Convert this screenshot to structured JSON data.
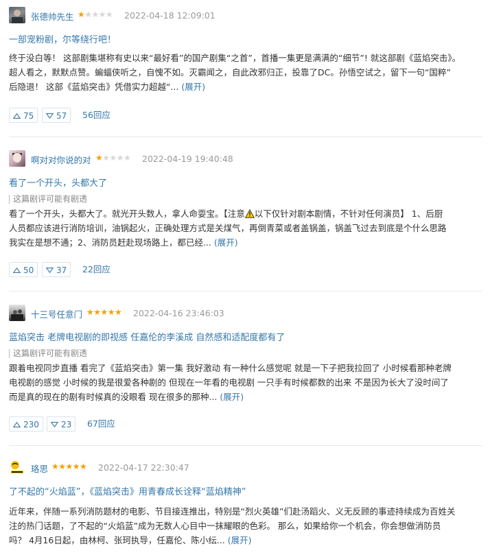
{
  "reviews": [
    {
      "username": "张德帅先生",
      "rating_stars": 1,
      "date": "2022-04-18 12:09:01",
      "title": "一部宠粉剧，尔等绕行吧！",
      "spoiler_note": "",
      "body_lines": [
        "终于没白等！  这部剧集堪称有史以来“最好看”的国产剧集“之首”，首播一集更是满满的“细节”! 就这部剧《蓝焰突击》。",
        "超人看之，默默点赞。蝙蝠侠听之，自愧不如。灭霸闻之，自此改邪归正，投靠了DC。孙悟空试之，留下一句“国粹”",
        "后隐退！ 这部《蓝焰突击》凭借实力超越“..."
      ],
      "expand": "(展开)",
      "useful": "75",
      "useless": "57",
      "replies": "56回应"
    },
    {
      "username": "啊对对你说的对",
      "rating_stars": 1,
      "date": "2022-04-19 19:40:48",
      "title": "看了一个开头，头都大了",
      "spoiler_note": "这篇剧评可能有剧透",
      "body_line1_before": "看了一个开头，头都大了。就光开头数人，拿人命耍宝。【注意",
      "body_line1_after": "以下仅针对剧本剧情，不针对任何演员】 1、后厨",
      "body_lines": [
        "人员都应该进行消防培训，油锅起火，正确处理方式是关煤气，再倒青菜或者盖锅盖，锅盖飞过去到底是个什么思路",
        "我实在是想不通；2、消防员赶赴现场路上，都已经..."
      ],
      "expand": "(展开)",
      "useful": "50",
      "useless": "37",
      "replies": "22回应"
    },
    {
      "username": "十三号任意门",
      "rating_stars": 5,
      "date": "2022-04-16 23:46:03",
      "title": "蓝焰突击 老牌电视剧的即视感 任嘉伦的李溪成 自然感和适配度都有了",
      "spoiler_note": "这篇剧评可能有剧透",
      "body_lines": [
        "跟着电视同步直播 看完了《蓝焰突击》第一集 我好激动 有一种什么感觉呢 就是一下子把我拉回了 小时候看那种老牌",
        "电视剧的感觉 小时候的我是很爱各种剧的 但现在一年看的电视剧 一只手有时候都数的出来 不是因为长大了没时间了",
        "而是真的现在的剧有时候真的没眼看 现在很多的那种..."
      ],
      "expand": "(展开)",
      "useful": "230",
      "useless": "23",
      "replies": "67回应"
    },
    {
      "username": "珞思",
      "rating_stars": 5,
      "date": "2022-04-17 22:30:47",
      "title": "了不起的“火焰蓝”，《蓝焰突击》用青春成长诠释“蓝焰精神”",
      "spoiler_note": "",
      "body_lines": [
        "近年来，伴随一系列消防题材的电影、节目接连推出，特别是“烈火英雄”们赴汤蹈火、义无反顾的事迹持续成为百姓关",
        "注的热门话题，了不起的“火焰蓝”成为无数人心目中一抹耀眼的色彩。  那么，如果给你一个机会，你会想做消防员",
        "吗？ 4月16日起，由林柯、张珂执导，任嘉伦、陈小纭..."
      ],
      "expand": "(展开)"
    }
  ],
  "colors": {
    "link": "#3377aa",
    "star": "#f4a100",
    "meta": "#999999"
  },
  "icons": {
    "useful": "triangle-up-icon",
    "useless": "triangle-down-icon",
    "warning": "warning-icon"
  }
}
